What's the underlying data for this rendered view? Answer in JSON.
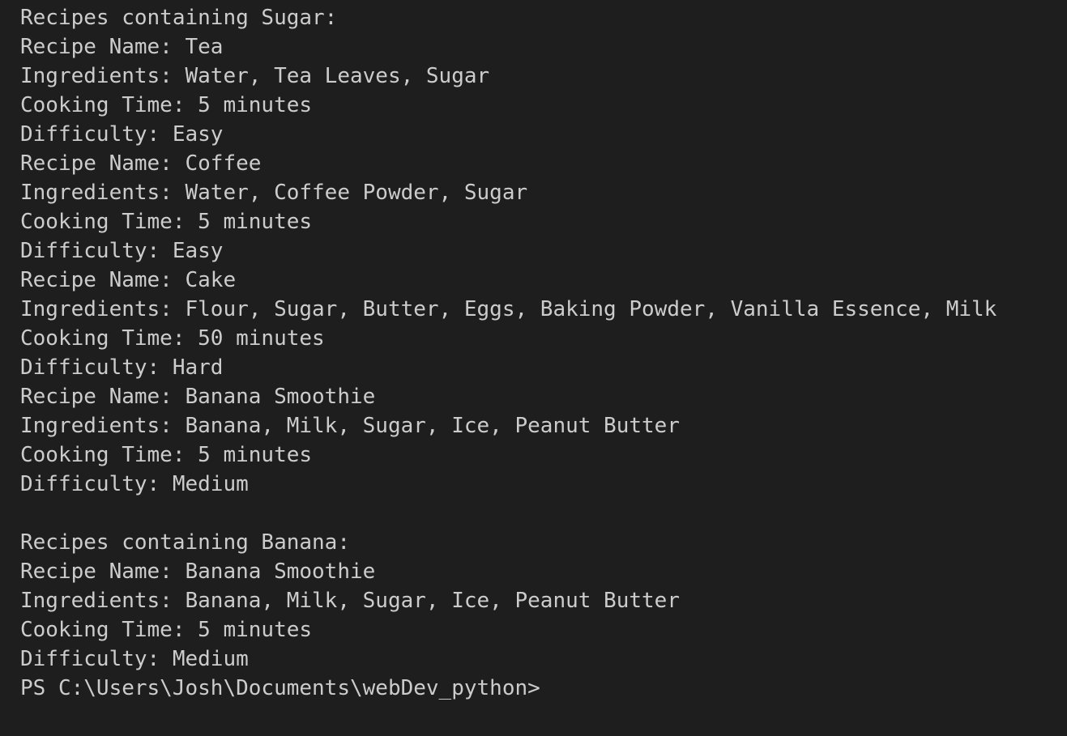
{
  "terminal": {
    "lines": [
      "Recipes containing Sugar:",
      "Recipe Name: Tea",
      "Ingredients: Water, Tea Leaves, Sugar",
      "Cooking Time: 5 minutes",
      "Difficulty: Easy",
      "Recipe Name: Coffee",
      "Ingredients: Water, Coffee Powder, Sugar",
      "Cooking Time: 5 minutes",
      "Difficulty: Easy",
      "Recipe Name: Cake",
      "Ingredients: Flour, Sugar, Butter, Eggs, Baking Powder, Vanilla Essence, Milk",
      "Cooking Time: 50 minutes",
      "Difficulty: Hard",
      "Recipe Name: Banana Smoothie",
      "Ingredients: Banana, Milk, Sugar, Ice, Peanut Butter",
      "Cooking Time: 5 minutes",
      "Difficulty: Medium",
      "",
      "Recipes containing Banana:",
      "Recipe Name: Banana Smoothie",
      "Ingredients: Banana, Milk, Sugar, Ice, Peanut Butter",
      "Cooking Time: 5 minutes",
      "Difficulty: Medium"
    ],
    "prompt": "PS C:\\Users\\Josh\\Documents\\webDev_python>",
    "colors": {
      "background": "#1e1e1e",
      "text": "#cccccc"
    }
  }
}
